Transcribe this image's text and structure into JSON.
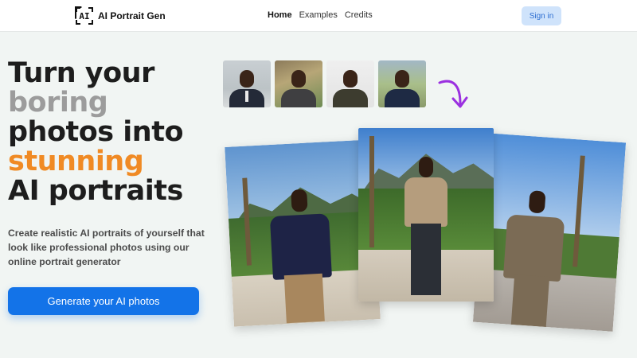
{
  "header": {
    "brand_mark": "AI",
    "brand_name": "AI Portrait Gen",
    "nav": [
      "Home",
      "Examples",
      "Credits"
    ],
    "nav_active": "Home",
    "signin_label": "Sign in"
  },
  "hero": {
    "headline_lines": [
      {
        "text": "Turn your",
        "tone": "dark"
      },
      {
        "text": "boring",
        "tone": "gray"
      },
      {
        "text": "photos into",
        "tone": "dark"
      },
      {
        "text": "stunning",
        "tone": "orange"
      },
      {
        "text": "AI portraits",
        "tone": "dark"
      }
    ],
    "subtext": "Create realistic AI portraits of yourself that look like professional photos using our online portrait generator",
    "cta_label": "Generate your AI photos"
  },
  "colors": {
    "accent_orange": "#f08a24",
    "primary_blue": "#1373e8",
    "signin_bg": "#cfe3fb",
    "arrow_purple": "#9b30e0"
  },
  "icons": {
    "arrow": "curved-arrow-down-icon",
    "logo": "ai-frame-logo-icon"
  }
}
